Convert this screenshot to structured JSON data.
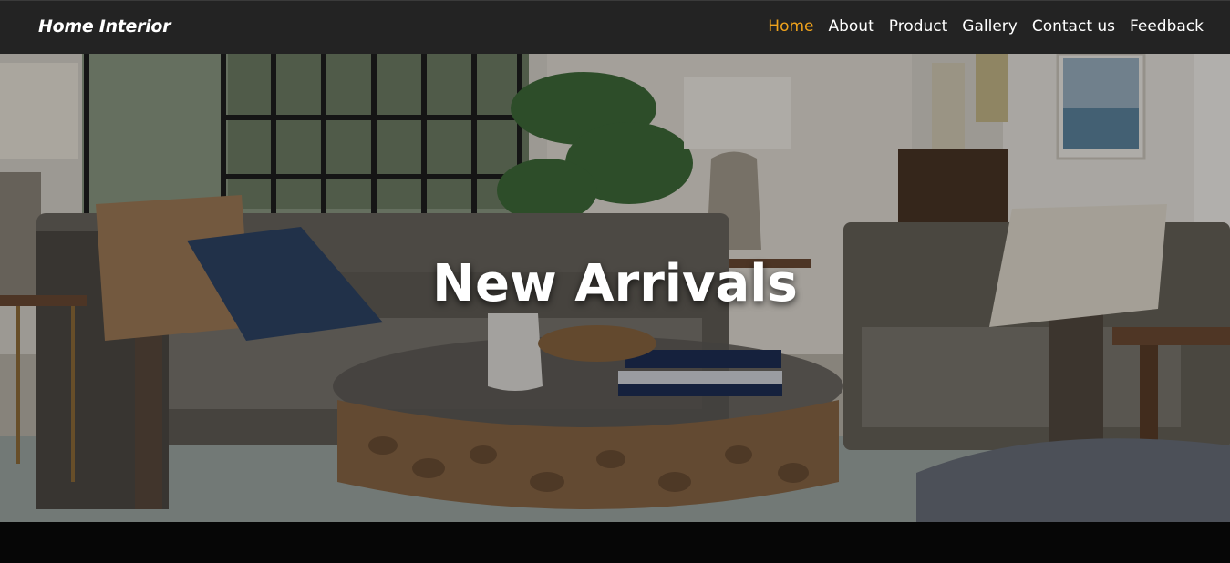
{
  "brand": {
    "name": "Home Interior"
  },
  "nav": {
    "items": [
      {
        "label": "Home",
        "active": true
      },
      {
        "label": "About",
        "active": false
      },
      {
        "label": "Product",
        "active": false
      },
      {
        "label": "Gallery",
        "active": false
      },
      {
        "label": "Contact us",
        "active": false
      },
      {
        "label": "Feedback",
        "active": false
      }
    ]
  },
  "hero": {
    "title": "New Arrivals"
  },
  "colors": {
    "navbar_bg": "#232323",
    "active_link": "#f0a31c",
    "text": "#ffffff"
  }
}
